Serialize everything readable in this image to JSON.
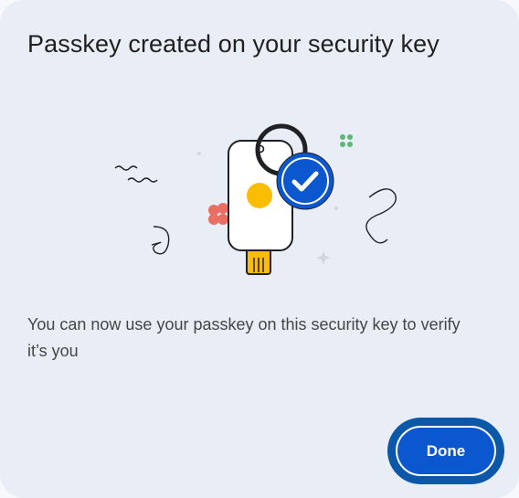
{
  "dialog": {
    "title": "Passkey created on your security key",
    "message": "You can now use your passkey on this security key to verify it’s you",
    "done_label": "Done",
    "illustration_icon": "security-key-with-checkmark"
  },
  "colors": {
    "dialog_bg": "#e9eef6",
    "primary": "#0b57d0",
    "check_badge": "#0b57d0",
    "key_dot": "#fbbc04",
    "confetti_red": "#ea6e63",
    "confetti_green": "#5bb974"
  }
}
